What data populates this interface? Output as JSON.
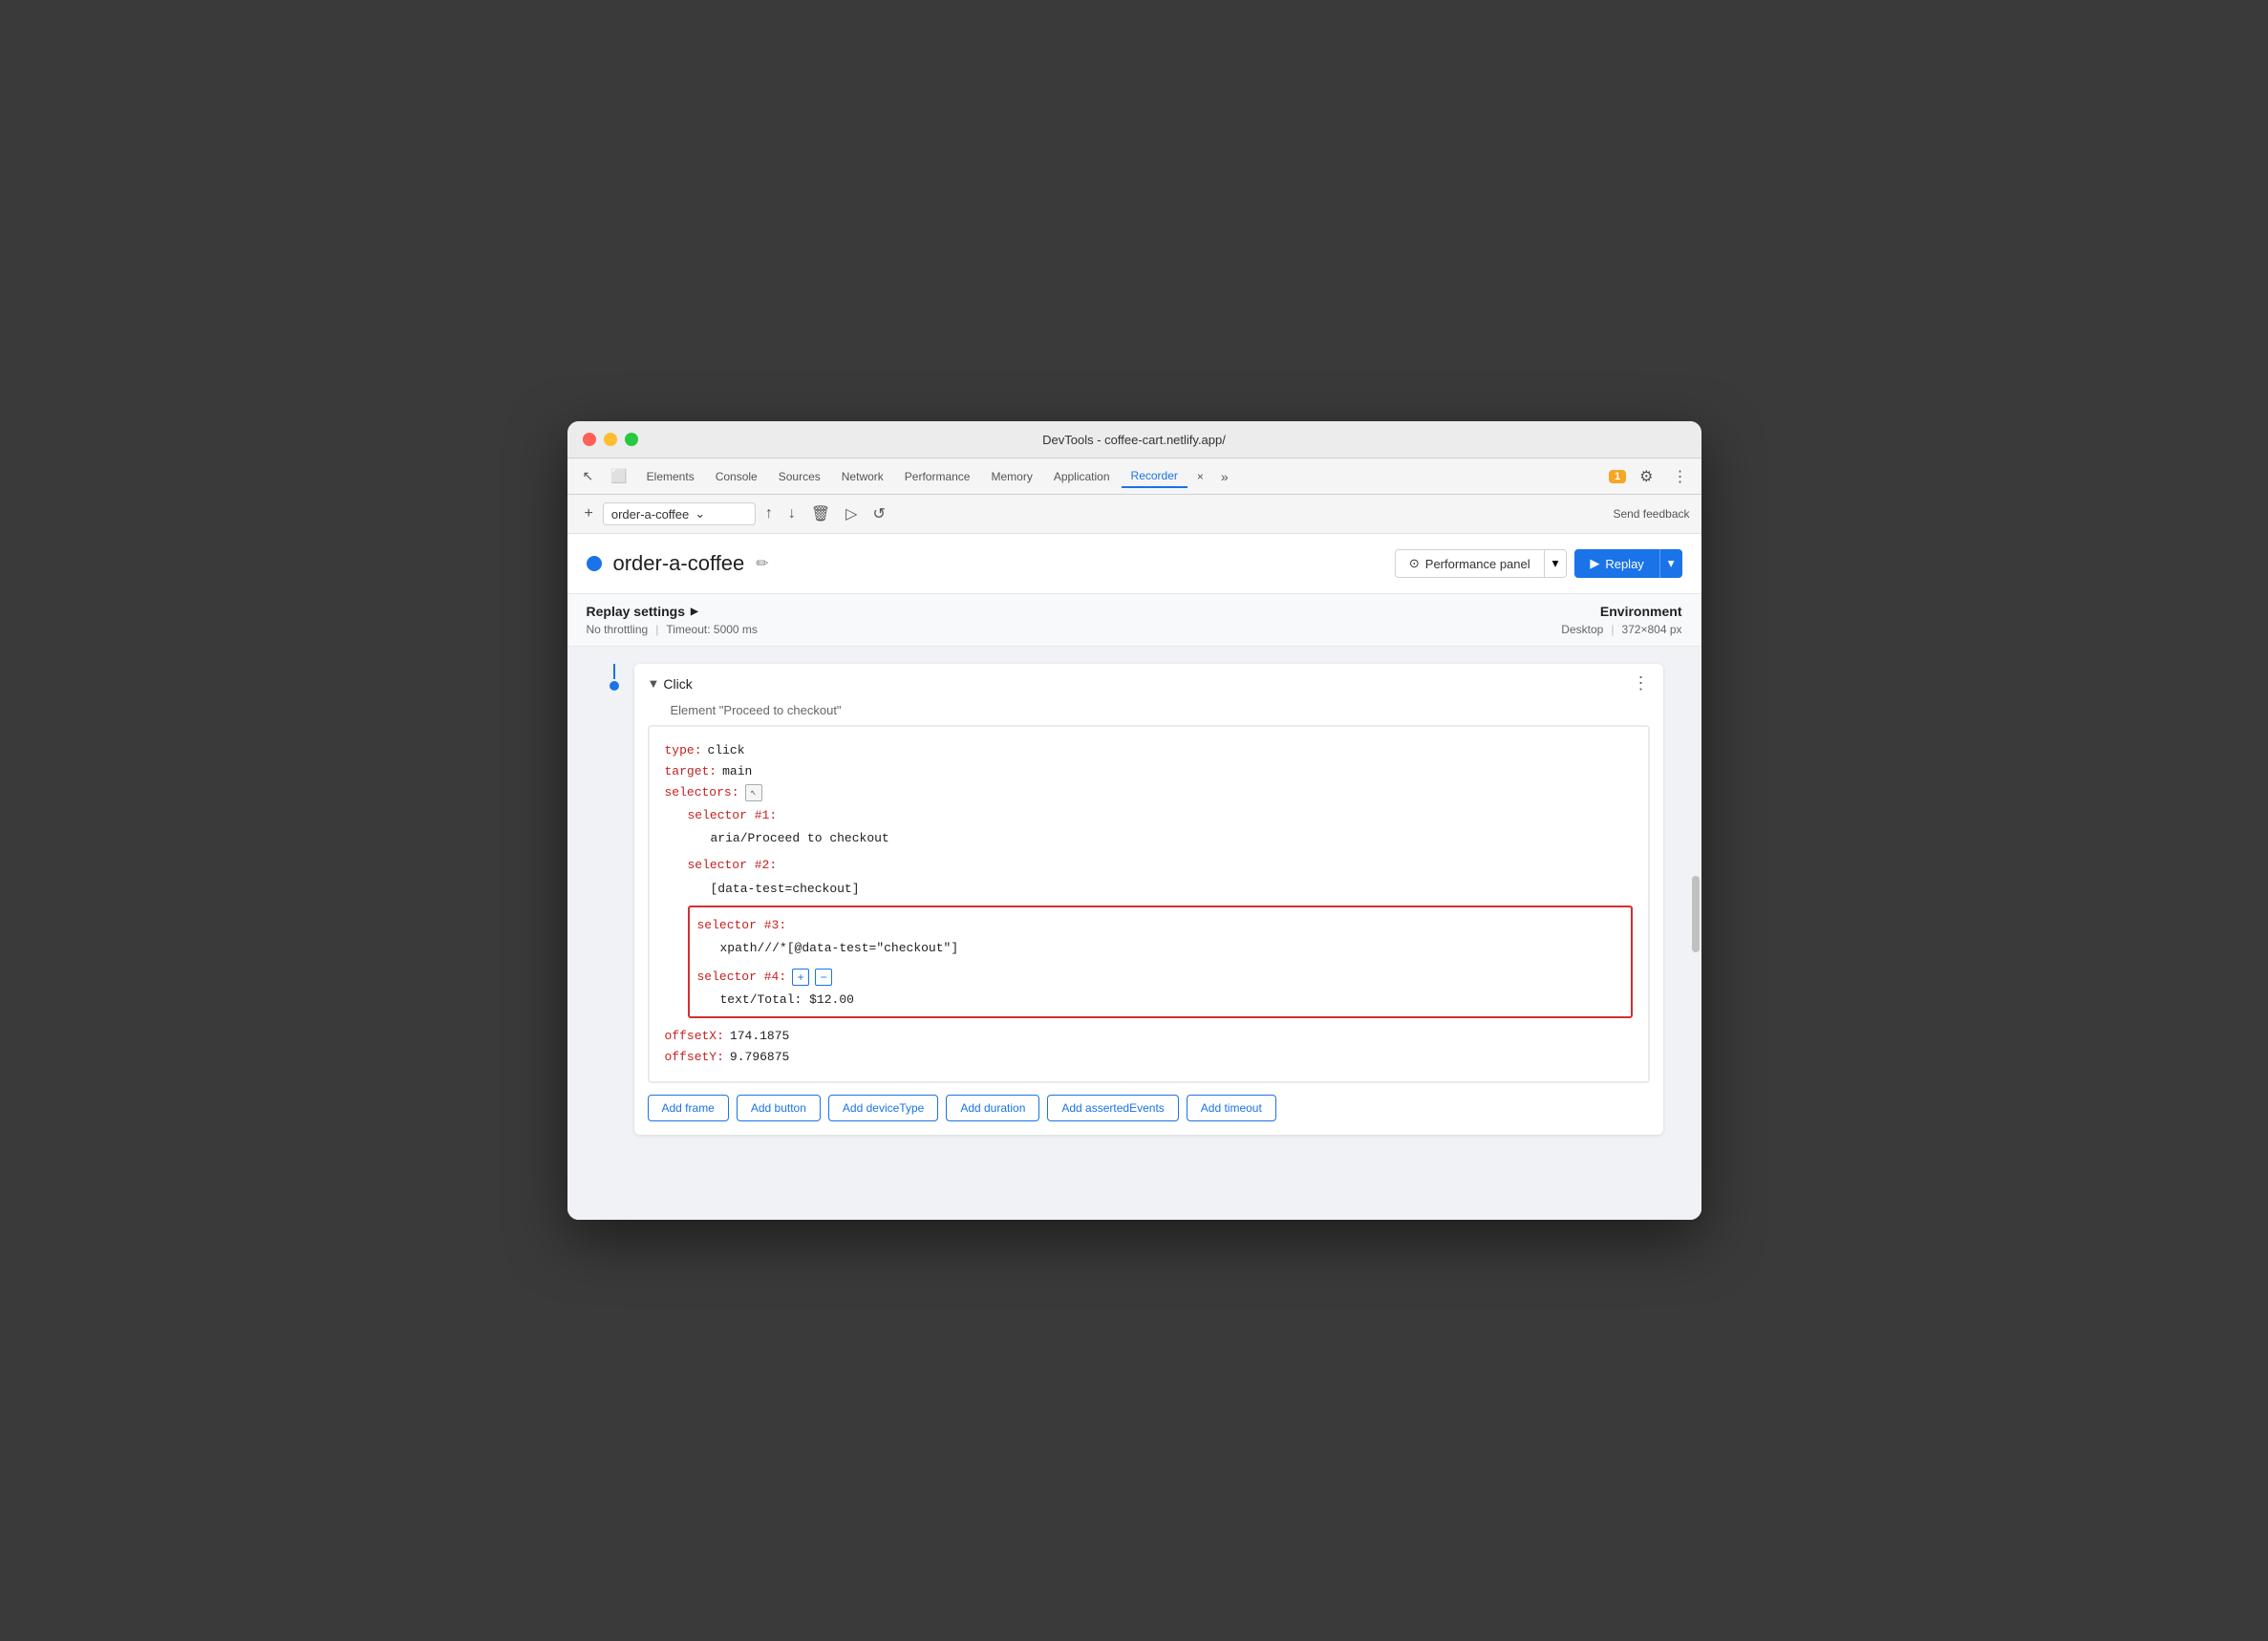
{
  "window": {
    "title": "DevTools - coffee-cart.netlify.app/"
  },
  "tabs": {
    "items": [
      {
        "label": "Elements",
        "active": false
      },
      {
        "label": "Console",
        "active": false
      },
      {
        "label": "Sources",
        "active": false
      },
      {
        "label": "Network",
        "active": false
      },
      {
        "label": "Performance",
        "active": false
      },
      {
        "label": "Memory",
        "active": false
      },
      {
        "label": "Application",
        "active": false
      },
      {
        "label": "Recorder",
        "active": true
      },
      {
        "label": "×",
        "active": false
      }
    ],
    "more_label": "»",
    "badge": "1",
    "gear_icon": "⚙",
    "dots_icon": "⋮"
  },
  "toolbar": {
    "new_icon": "+",
    "export_icon": "↑",
    "import_icon": "↓",
    "delete_icon": "🗑",
    "play_icon": "▷",
    "replay_icon": "↺",
    "recording_name": "order-a-coffee",
    "chevron_icon": "⌄",
    "send_feedback": "Send feedback"
  },
  "recording": {
    "dot_color": "#1a73e8",
    "title": "order-a-coffee",
    "edit_icon": "✏",
    "perf_panel_label": "Performance panel",
    "perf_icon": "⊙",
    "perf_chevron": "▾",
    "replay_label": "Replay",
    "replay_play_icon": "▶",
    "replay_chevron": "▾"
  },
  "replay_settings": {
    "title": "Replay settings",
    "arrow_icon": "▶",
    "throttling": "No throttling",
    "separator": "|",
    "timeout": "Timeout: 5000 ms"
  },
  "environment": {
    "title": "Environment",
    "device": "Desktop",
    "separator": "|",
    "size": "372×804 px"
  },
  "step": {
    "event_type": "Click",
    "element_label": "Element \"Proceed to checkout\"",
    "more_icon": "⋮",
    "code": {
      "type_key": "type:",
      "type_val": "click",
      "target_key": "target:",
      "target_val": "main",
      "selectors_key": "selectors:",
      "selector_icon": "↖",
      "selector1_key": "selector #1:",
      "selector1_val": "aria/Proceed to checkout",
      "selector2_key": "selector #2:",
      "selector2_val": "[data-test=checkout]",
      "selector3_key": "selector #3:",
      "selector3_val": "xpath///*[@data-test=\"checkout\"]",
      "selector4_key": "selector #4:",
      "selector4_val": "text/Total: $12.00",
      "offsetX_key": "offsetX:",
      "offsetX_val": "174.1875",
      "offsetY_key": "offsetY:",
      "offsetY_val": "9.796875"
    },
    "actions": {
      "add_frame": "Add frame",
      "add_button": "Add button",
      "add_device_type": "Add deviceType",
      "add_duration": "Add duration",
      "add_asserted_events": "Add assertedEvents",
      "add_timeout": "Add timeout"
    }
  }
}
